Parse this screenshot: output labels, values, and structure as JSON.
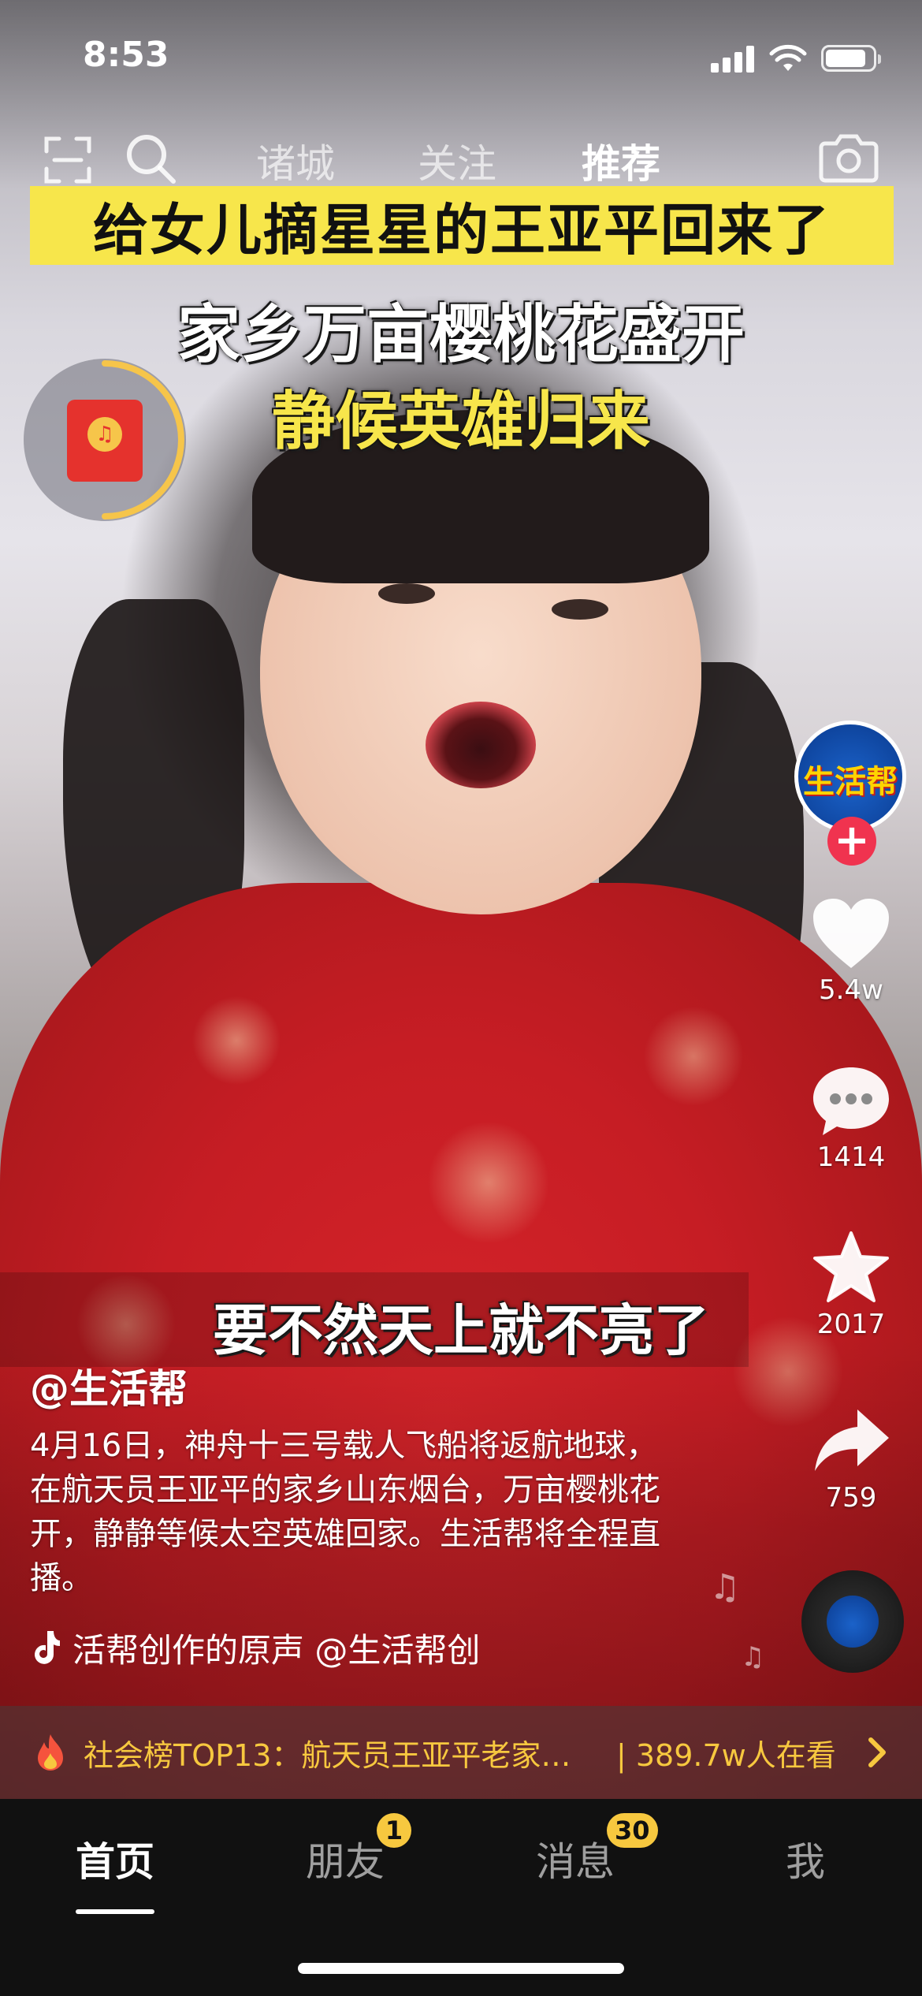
{
  "status_bar": {
    "time": "8:53"
  },
  "top_nav": {
    "tabs": [
      {
        "label": "诸城"
      },
      {
        "label": "关注"
      },
      {
        "label": "推荐"
      }
    ]
  },
  "video": {
    "headline": "给女儿摘星星的王亚平回来了",
    "subhead1": "家乡万亩樱桃花盛开",
    "subhead2": "静候英雄归来",
    "subtitle": "要不然天上就不亮了"
  },
  "rail": {
    "avatar_text": "生活帮",
    "like_count": "5.4w",
    "comment_count": "1414",
    "favorite_count": "2017",
    "share_count": "759"
  },
  "post": {
    "author": "@生活帮",
    "description": "4月16日，神舟十三号载人飞船将返航地球，在航天员王亚平的家乡山东烟台，万亩樱桃花开，静静等候太空英雄回家。生活帮将全程直播。",
    "music": "活帮创作的原声    @生活帮创"
  },
  "hot_banner": {
    "title": "社会榜TOP13：航天员王亚平老家…",
    "viewers": "| 389.7w人在看"
  },
  "tabbar": {
    "items": [
      {
        "label": "首页"
      },
      {
        "label": "朋友",
        "badge": "1"
      },
      {
        "label": "消息",
        "badge": "30"
      },
      {
        "label": "我"
      }
    ]
  },
  "colors": {
    "accent_yellow": "#f7e64b",
    "banner_gold": "#f7c83f",
    "follow_red": "#f0334f"
  },
  "icons": [
    "scan-icon",
    "search-icon",
    "camera-icon",
    "red-packet-icon",
    "heart-icon",
    "comment-icon",
    "star-icon",
    "share-icon",
    "music-disc-icon",
    "tiktok-note-icon",
    "fire-icon",
    "chevron-right-icon"
  ]
}
